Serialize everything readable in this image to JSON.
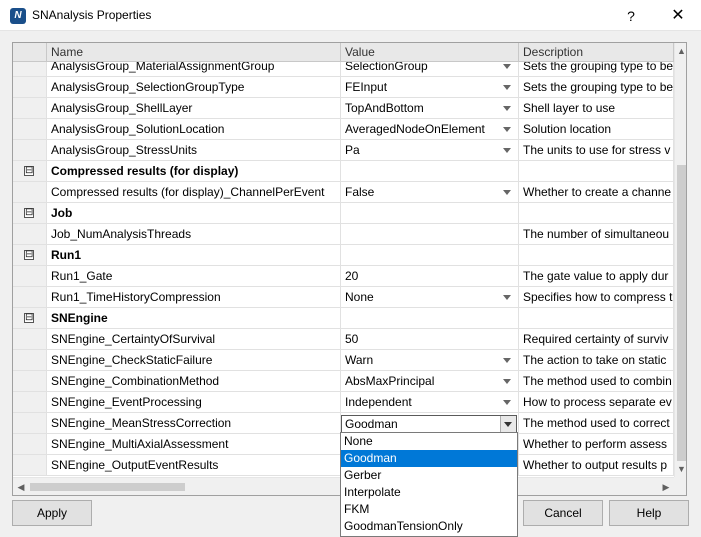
{
  "window": {
    "title": "SNAnalysis Properties",
    "icon_label": "N",
    "help_glyph": "?",
    "close_glyph": "✕"
  },
  "grid": {
    "columns": [
      "Name",
      "Value",
      "Description"
    ],
    "rows": [
      {
        "type": "prop",
        "name": "AnalysisGroup_MaterialAssignmentGroup",
        "value": "SelectionGroup",
        "dropdown": true,
        "description": "Sets the grouping type to be"
      },
      {
        "type": "prop",
        "name": "AnalysisGroup_SelectionGroupType",
        "value": "FEInput",
        "dropdown": true,
        "description": "Sets the grouping type to be"
      },
      {
        "type": "prop",
        "name": "AnalysisGroup_ShellLayer",
        "value": "TopAndBottom",
        "dropdown": true,
        "description": "Shell layer to use"
      },
      {
        "type": "prop",
        "name": "AnalysisGroup_SolutionLocation",
        "value": "AveragedNodeOnElement",
        "dropdown": true,
        "description": "Solution location"
      },
      {
        "type": "prop",
        "name": "AnalysisGroup_StressUnits",
        "value": "Pa",
        "dropdown": true,
        "description": "The units to use for stress v"
      },
      {
        "type": "category",
        "name": "Compressed results (for display)",
        "toggle": "⊟"
      },
      {
        "type": "prop",
        "name": "Compressed results (for display)_ChannelPerEvent",
        "value": "False",
        "dropdown": true,
        "description": "Whether to create a channe"
      },
      {
        "type": "category",
        "name": "Job",
        "toggle": "⊟"
      },
      {
        "type": "prop",
        "name": "Job_NumAnalysisThreads",
        "value": "",
        "dropdown": false,
        "description": "The number of simultaneou"
      },
      {
        "type": "category",
        "name": "Run1",
        "toggle": "⊟"
      },
      {
        "type": "prop",
        "name": "Run1_Gate",
        "value": "20",
        "dropdown": false,
        "description": "The gate value to apply dur"
      },
      {
        "type": "prop",
        "name": "Run1_TimeHistoryCompression",
        "value": "None",
        "dropdown": true,
        "description": "Specifies how to compress t"
      },
      {
        "type": "category",
        "name": "SNEngine",
        "toggle": "⊟"
      },
      {
        "type": "prop",
        "name": "SNEngine_CertaintyOfSurvival",
        "value": "50",
        "dropdown": false,
        "description": "Required certainty of surviv"
      },
      {
        "type": "prop",
        "name": "SNEngine_CheckStaticFailure",
        "value": "Warn",
        "dropdown": true,
        "description": "The action to take on static"
      },
      {
        "type": "prop",
        "name": "SNEngine_CombinationMethod",
        "value": "AbsMaxPrincipal",
        "dropdown": true,
        "description": "The method used to combin"
      },
      {
        "type": "prop",
        "name": "SNEngine_EventProcessing",
        "value": "Independent",
        "dropdown": true,
        "description": "How to process separate ev"
      },
      {
        "type": "prop",
        "name": "SNEngine_MeanStressCorrection",
        "value": "",
        "dropdown": false,
        "active": true,
        "description": "The method used to correct"
      },
      {
        "type": "prop",
        "name": "SNEngine_MultiAxialAssessment",
        "value": "",
        "dropdown": false,
        "description": "Whether to perform assess"
      },
      {
        "type": "prop",
        "name": "SNEngine_OutputEventResults",
        "value": "",
        "dropdown": false,
        "description": "Whether to output results p"
      }
    ]
  },
  "active_editor": {
    "value": "Goodman",
    "options": [
      "None",
      "Goodman",
      "Gerber",
      "Interpolate",
      "FKM",
      "GoodmanTensionOnly"
    ],
    "selected_index": 1
  },
  "scroll": {
    "up": "▲",
    "down": "▼",
    "left": "◀",
    "right": "▶"
  },
  "buttons": {
    "apply": "Apply",
    "cancel": "Cancel",
    "help": "Help"
  }
}
